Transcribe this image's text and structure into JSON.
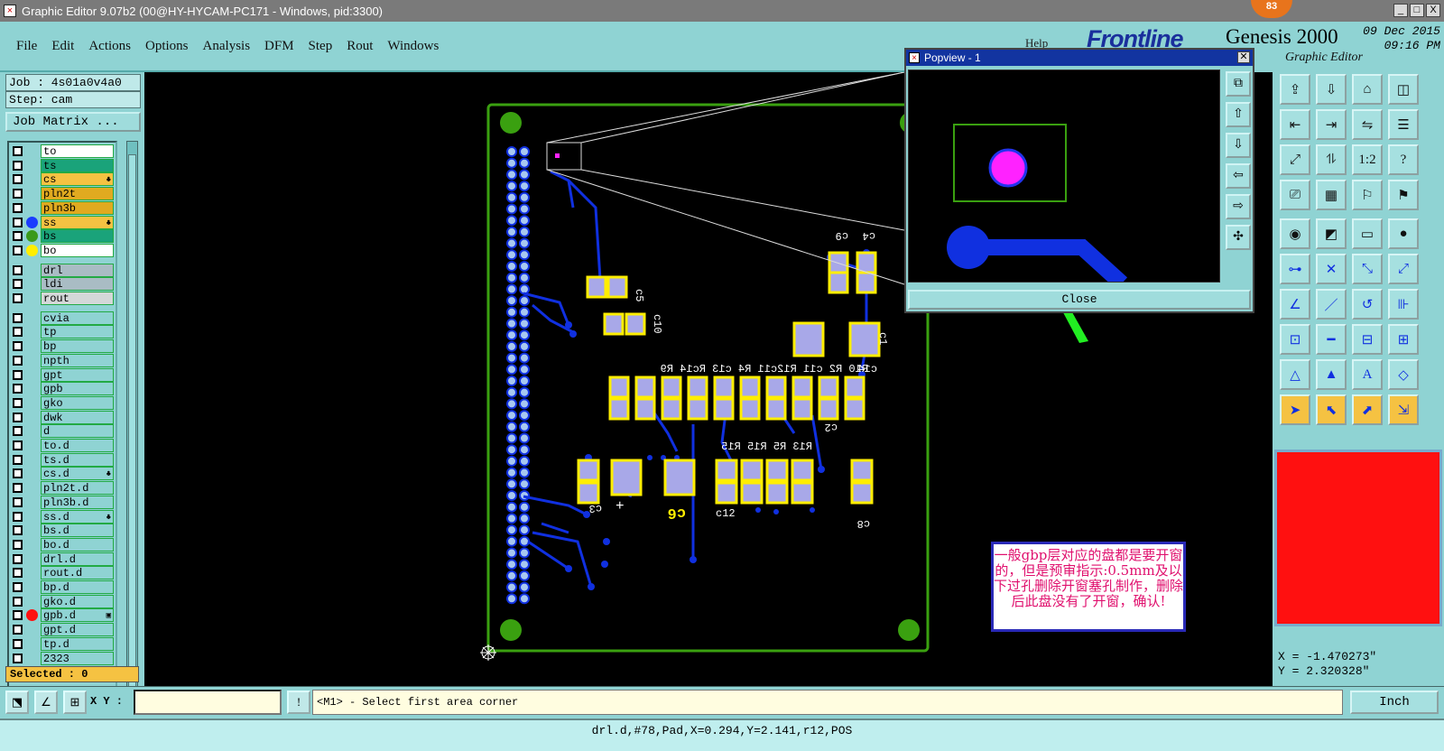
{
  "window": {
    "title": "Graphic Editor 9.07b2 (00@HY-HYCAM-PC171 - Windows, pid:3300)",
    "badge": "83",
    "min": "_",
    "max": "□",
    "close": "X"
  },
  "menu": [
    "File",
    "Edit",
    "Actions",
    "Options",
    "Analysis",
    "DFM",
    "Step",
    "Rout",
    "Windows"
  ],
  "help_label": "Help",
  "brand": {
    "logo": "Frontline",
    "product": "Genesis 2000",
    "subtitle": "Graphic Editor",
    "date": "09 Dec 2015",
    "time": "09:16 PM"
  },
  "job": {
    "job_line": "Job : 4s01a0v4a0",
    "step_line": "Step: cam",
    "job_matrix_label": "Job Matrix ..."
  },
  "layers": [
    {
      "name": "to",
      "bg": "#ffffff",
      "dot": ""
    },
    {
      "name": "ts",
      "bg": "#1aa37a",
      "dot": ""
    },
    {
      "name": "cs",
      "bg": "#f5c242",
      "dot": "",
      "mark": "♣"
    },
    {
      "name": "pln2t",
      "bg": "#e0aa20",
      "dot": ""
    },
    {
      "name": "pln3b",
      "bg": "#e0aa20",
      "dot": ""
    },
    {
      "name": "ss",
      "bg": "#f5c242",
      "dot": "#1a3cff",
      "mark": "♣"
    },
    {
      "name": "bs",
      "bg": "#1aa37a",
      "dot": "#3a9a1a"
    },
    {
      "name": "bo",
      "bg": "#ffffff",
      "dot": "#ffee00"
    },
    {
      "name": "drl",
      "bg": "#a9bcc4",
      "dot": ""
    },
    {
      "name": "ldi",
      "bg": "#a9bcc4",
      "dot": ""
    },
    {
      "name": "rout",
      "bg": "#d4d8d8",
      "dot": ""
    },
    {
      "name": "cvia",
      "bg": "#8fd3d3",
      "dot": ""
    },
    {
      "name": "tp",
      "bg": "#8fd3d3",
      "dot": ""
    },
    {
      "name": "bp",
      "bg": "#8fd3d3",
      "dot": ""
    },
    {
      "name": "npth",
      "bg": "#8fd3d3",
      "dot": ""
    },
    {
      "name": "gpt",
      "bg": "#8fd3d3",
      "dot": ""
    },
    {
      "name": "gpb",
      "bg": "#8fd3d3",
      "dot": ""
    },
    {
      "name": "gko",
      "bg": "#8fd3d3",
      "dot": ""
    },
    {
      "name": "dwk",
      "bg": "#8fd3d3",
      "dot": ""
    },
    {
      "name": "d",
      "bg": "#8fd3d3",
      "dot": ""
    },
    {
      "name": "to.d",
      "bg": "#8fd3d3",
      "dot": ""
    },
    {
      "name": "ts.d",
      "bg": "#8fd3d3",
      "dot": ""
    },
    {
      "name": "cs.d",
      "bg": "#8fd3d3",
      "dot": "",
      "mark": "♣"
    },
    {
      "name": "pln2t.d",
      "bg": "#8fd3d3",
      "dot": ""
    },
    {
      "name": "pln3b.d",
      "bg": "#8fd3d3",
      "dot": ""
    },
    {
      "name": "ss.d",
      "bg": "#8fd3d3",
      "dot": "",
      "mark": "♣"
    },
    {
      "name": "bs.d",
      "bg": "#8fd3d3",
      "dot": ""
    },
    {
      "name": "bo.d",
      "bg": "#8fd3d3",
      "dot": ""
    },
    {
      "name": "drl.d",
      "bg": "#8fd3d3",
      "dot": ""
    },
    {
      "name": "rout.d",
      "bg": "#8fd3d3",
      "dot": ""
    },
    {
      "name": "bp.d",
      "bg": "#8fd3d3",
      "dot": ""
    },
    {
      "name": "gko.d",
      "bg": "#8fd3d3",
      "dot": ""
    },
    {
      "name": "gpb.d",
      "bg": "#8fd3d3",
      "dot": "#ff1010",
      "mark": "▣"
    },
    {
      "name": "gpt.d",
      "bg": "#8fd3d3",
      "dot": ""
    },
    {
      "name": "tp.d",
      "bg": "#8fd3d3",
      "dot": ""
    },
    {
      "name": "2323",
      "bg": "#8fd3d3",
      "dot": ""
    }
  ],
  "selected_label": "Selected : 0",
  "popview": {
    "title": "Popview - 1",
    "close_label": "Close"
  },
  "pcb_labels": {
    "c5": "c5",
    "c10": "c10",
    "c9": "c9",
    "c4": "c4",
    "c1": "c1",
    "c14": "c14",
    "top_row": "R10 R2 c11 R12c11 R4 c13 Rc14 R9",
    "c2": "c2",
    "c3": "c3",
    "c6": "c6",
    "c12": "c12",
    "c8": "c8",
    "mid_row": "R13 R5 R15 R15",
    "plus": "+"
  },
  "annotation": "一般gbp层对应的盘都是要开窗的，但是预审指示:0.5mm及以下过孔删除开窗塞孔制作，删除后此盘没有了开窗，确认!",
  "coords": {
    "x": "X = -1.470273\"",
    "y": "Y = 2.320328\""
  },
  "bottom": {
    "xy_label": "X Y :",
    "xy_value": "",
    "excl": "!",
    "prompt": "<M1> - Select first area corner",
    "units": "Inch"
  },
  "status": "drl.d,#78,Pad,X=0.294,Y=2.141,r12,POS",
  "colors": {
    "bg": "#8fd3d3",
    "canvas": "#000000",
    "pad": "#a8a8e8",
    "trace": "#1030e0",
    "outline": "#3aa010",
    "arrow": "#22ee22"
  }
}
